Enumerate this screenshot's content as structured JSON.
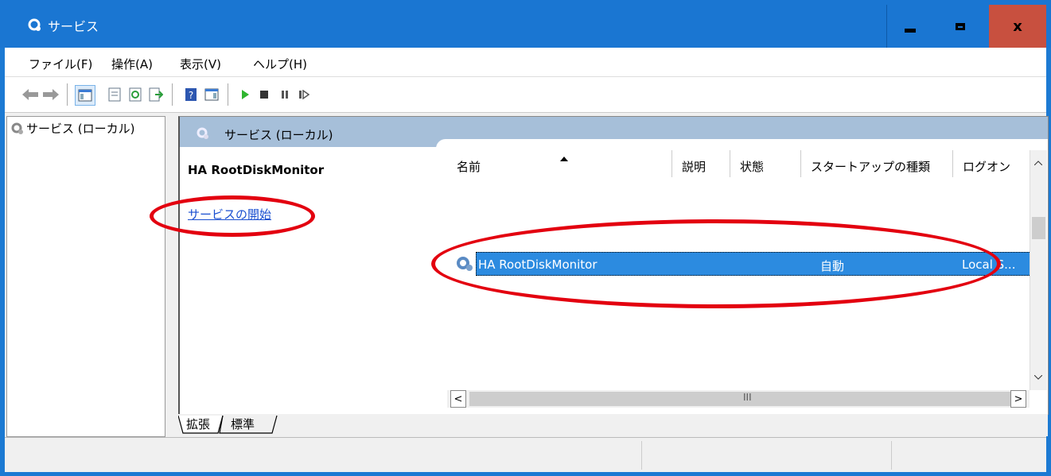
{
  "window": {
    "title": "サービス",
    "minimize_icon": "minimize-icon",
    "maximize_icon": "maximize-icon",
    "close_label": "x"
  },
  "menu": [
    {
      "label": "ファイル(F)"
    },
    {
      "label": "操作(A)"
    },
    {
      "label": "表示(V)"
    },
    {
      "label": "ヘルプ(H)"
    }
  ],
  "toolbar": {
    "icons": [
      "back-icon",
      "forward-icon",
      "show-hide-console-tree-icon",
      "properties-icon",
      "refresh-icon",
      "export-list-icon",
      "help-icon",
      "show-action-pane-icon",
      "start-service-icon",
      "stop-service-icon",
      "pause-service-icon",
      "resume-service-icon"
    ]
  },
  "tree": {
    "root_label": "サービス (ローカル)"
  },
  "main": {
    "header_label": "サービス (ローカル)",
    "selected_service_title": "HA RootDiskMonitor",
    "start_link": "サービスの開始"
  },
  "list": {
    "columns": [
      {
        "label": "名前"
      },
      {
        "label": "説明"
      },
      {
        "label": "状態"
      },
      {
        "label": "スタートアップの種類"
      },
      {
        "label": "ログオン"
      }
    ],
    "rows": [
      {
        "name": "HA RootDiskMonitor",
        "description": "",
        "status": "",
        "startup_type": "自動",
        "logon": "Local S..."
      }
    ]
  },
  "scroll": {
    "h_thumb_glyph": "III",
    "left": "<",
    "right": ">",
    "up": "^",
    "down": "v"
  },
  "tabs": [
    {
      "label": "拡張",
      "active": true
    },
    {
      "label": "標準",
      "active": false
    }
  ],
  "colors": {
    "titlebar": "#1a76d2",
    "selection": "#2c8be0",
    "annotation": "#e3000f",
    "link": "#1a4fd0"
  }
}
